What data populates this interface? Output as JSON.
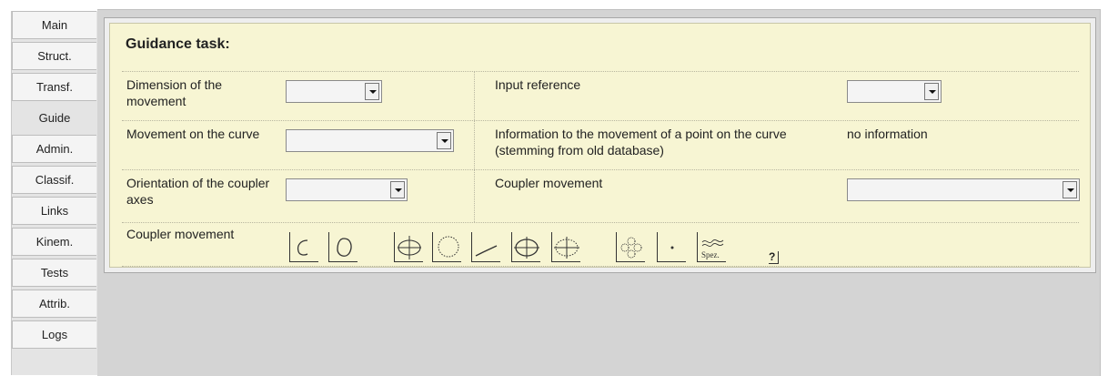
{
  "tabs": [
    {
      "label": "Main"
    },
    {
      "label": "Struct."
    },
    {
      "label": "Transf."
    },
    {
      "label": "Guide"
    },
    {
      "label": "Admin."
    },
    {
      "label": "Classif."
    },
    {
      "label": "Links"
    },
    {
      "label": "Kinem."
    },
    {
      "label": "Tests"
    },
    {
      "label": "Attrib."
    },
    {
      "label": "Logs"
    }
  ],
  "active_tab": "Guide",
  "panel": {
    "title": "Guidance task:",
    "dimension_label": "Dimension of the movement",
    "input_reference_label": "Input reference",
    "movement_curve_label": "Movement on the curve",
    "info_label": "Information to the movement of a point on the curve (stemming from old database)",
    "info_value": "no information",
    "orientation_label": "Orientation of the coupler axes",
    "coupler_movement_label": "Coupler movement",
    "coupler_movement_icons_label": "Coupler movement",
    "spez_label": "Spez.",
    "help_label": "?"
  },
  "icons": [
    "open-curve-icon",
    "closed-curve-icon",
    "circle-with-axis-icon",
    "dotted-circle-icon",
    "straight-line-icon",
    "crossed-ellipse-icon",
    "dotted-crossed-ellipse-icon",
    "dotted-loops-icon",
    "single-point-icon",
    "special-curve-icon"
  ]
}
